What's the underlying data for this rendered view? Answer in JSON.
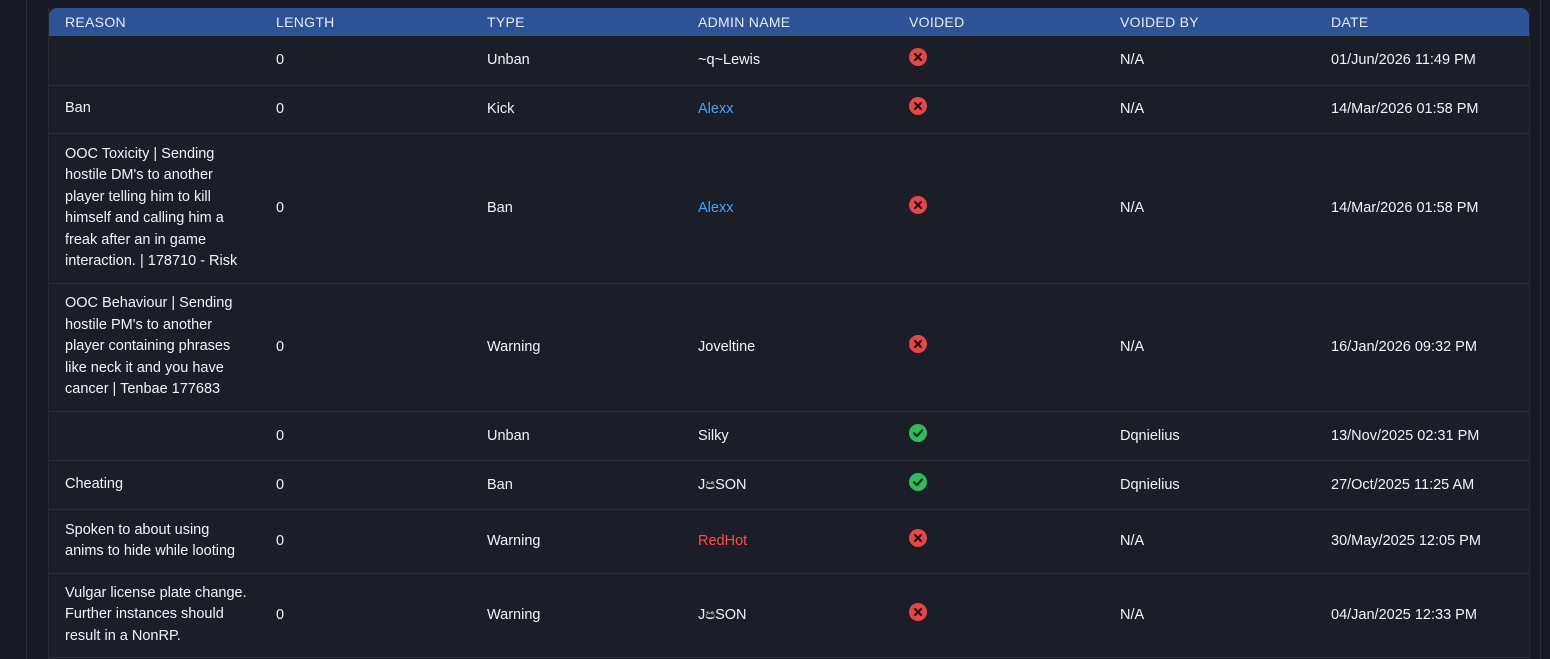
{
  "columns": [
    "REASON",
    "LENGTH",
    "TYPE",
    "ADMIN NAME",
    "VOIDED",
    "VOIDED BY",
    "DATE"
  ],
  "colors": {
    "header_bg": "#2d5295",
    "row_bg": "#1b1e27",
    "admin_blue": "#3ea6ff",
    "admin_red": "#ff4a4a",
    "voided_no": "#e5464a",
    "voided_yes": "#2fbd5c"
  },
  "rows": [
    {
      "reason": "",
      "length": "0",
      "type": "Unban",
      "admin": "~q~Lewis",
      "admin_color": "default",
      "voided": false,
      "voided_icon": "x-circle-icon",
      "voided_by": "N/A",
      "date": "01/Jun/2026 11:49 PM"
    },
    {
      "reason": "Ban",
      "length": "0",
      "type": "Kick",
      "admin": "Alexx",
      "admin_color": "blue",
      "voided": false,
      "voided_icon": "x-circle-icon",
      "voided_by": "N/A",
      "date": "14/Mar/2026 01:58 PM"
    },
    {
      "reason": "OOC Toxicity | Sending hostile DM's to another player telling him to kill himself and calling him a freak after an in game interaction. | 178710 - Risk",
      "length": "0",
      "type": "Ban",
      "admin": "Alexx",
      "admin_color": "blue",
      "voided": false,
      "voided_icon": "x-circle-icon",
      "voided_by": "N/A",
      "date": "14/Mar/2026 01:58 PM"
    },
    {
      "reason": "OOC Behaviour | Sending hostile PM's to another player containing phrases like neck it and you have cancer | Tenbae 177683",
      "length": "0",
      "type": "Warning",
      "admin": "Joveltine",
      "admin_color": "default",
      "voided": false,
      "voided_icon": "x-circle-icon",
      "voided_by": "N/A",
      "date": "16/Jan/2026 09:32 PM"
    },
    {
      "reason": "",
      "length": "0",
      "type": "Unban",
      "admin": "Silky",
      "admin_color": "default",
      "voided": true,
      "voided_icon": "check-circle-icon",
      "voided_by": "Dqnielius",
      "date": "13/Nov/2025 02:31 PM"
    },
    {
      "reason": "Cheating",
      "length": "0",
      "type": "Ban",
      "admin": "JපSON",
      "admin_color": "default",
      "voided": true,
      "voided_icon": "check-circle-icon",
      "voided_by": "Dqnielius",
      "date": "27/Oct/2025 11:25 AM"
    },
    {
      "reason": "Spoken to about using anims to hide while looting",
      "length": "0",
      "type": "Warning",
      "admin": "RedHot",
      "admin_color": "red",
      "voided": false,
      "voided_icon": "x-circle-icon",
      "voided_by": "N/A",
      "date": "30/May/2025 12:05 PM"
    },
    {
      "reason": "Vulgar license plate change. Further instances should result in a NonRP.",
      "length": "0",
      "type": "Warning",
      "admin": "JපSON",
      "admin_color": "default",
      "voided": false,
      "voided_icon": "x-circle-icon",
      "voided_by": "N/A",
      "date": "04/Jan/2025 12:33 PM"
    }
  ]
}
